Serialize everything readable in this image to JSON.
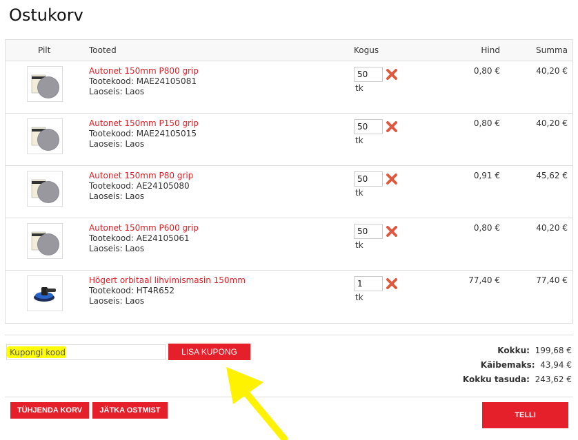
{
  "page": {
    "title": "Ostukorv"
  },
  "table": {
    "headers": {
      "image": "Pilt",
      "products": "Tooted",
      "quantity": "Kogus",
      "price": "Hind",
      "total": "Summa"
    },
    "rows": [
      {
        "name": "Autonet 150mm P800 grip",
        "code": "Tootekood: MAE24105081",
        "stock": "Laoseis: Laos",
        "qty": "50",
        "unit": "tk",
        "price": "0,80 €",
        "total": "40,20 €",
        "image": "sanding-disc-pack"
      },
      {
        "name": "Autonet 150mm P150 grip",
        "code": "Tootekood: MAE24105015",
        "stock": "Laoseis: Laos",
        "qty": "50",
        "unit": "tk",
        "price": "0,80 €",
        "total": "40,20 €",
        "image": "sanding-disc-pack"
      },
      {
        "name": "Autonet 150mm P80 grip",
        "code": "Tootekood: AE24105080",
        "stock": "Laoseis: Laos",
        "qty": "50",
        "unit": "tk",
        "price": "0,91 €",
        "total": "45,62 €",
        "image": "sanding-disc-pack"
      },
      {
        "name": "Autonet 150mm P600 grip",
        "code": "Tootekood: AE24105061",
        "stock": "Laoseis: Laos",
        "qty": "50",
        "unit": "tk",
        "price": "0,80 €",
        "total": "40,20 €",
        "image": "sanding-disc-pack"
      },
      {
        "name": "Högert orbitaal lihvimismasin 150mm",
        "code": "Tootekood: HT4R652",
        "stock": "Laoseis: Laos",
        "qty": "1",
        "unit": "tk",
        "price": "77,40 €",
        "total": "77,40 €",
        "image": "orbital-sander"
      }
    ]
  },
  "coupon": {
    "placeholder": "Kupongi kood",
    "button": "LISA KUPONG"
  },
  "totals": {
    "subtotal_label": "Kokku:",
    "subtotal": "199,68 €",
    "vat_label": "Käibemaks:",
    "vat": "43,94 €",
    "grand_label": "Kokku tasuda:",
    "grand": "243,62 €"
  },
  "actions": {
    "empty_cart": "TÜHJENDA KORV",
    "continue": "JÄTKA OSTMIST",
    "order": "TELLI"
  },
  "colors": {
    "accent": "#e5202b",
    "link": "#d8232a",
    "highlight": "#ffff00"
  },
  "icons": {
    "remove": "remove-x-icon",
    "annotation": "yellow-arrow-annotation"
  }
}
